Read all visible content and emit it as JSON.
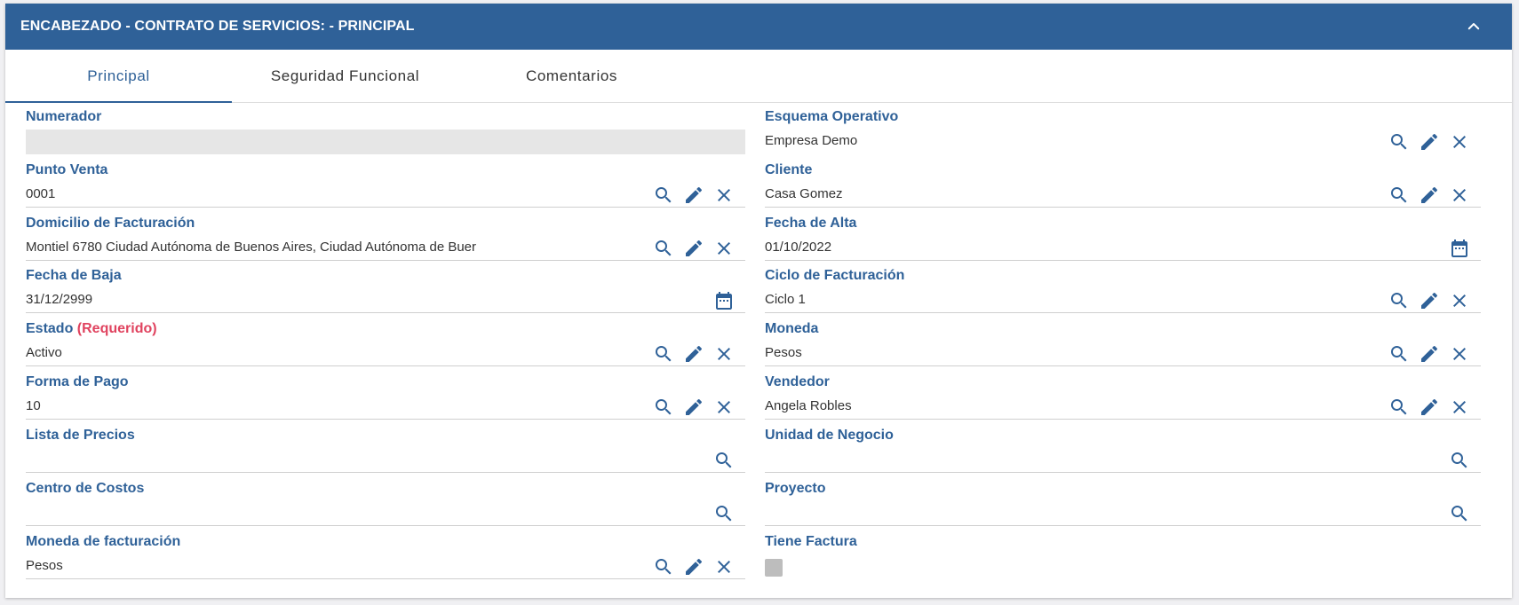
{
  "header": {
    "title": "ENCABEZADO - CONTRATO DE SERVICIOS: - PRINCIPAL",
    "collapse_icon": "chevron-up-icon"
  },
  "tabs": [
    {
      "label": "Principal",
      "active": true
    },
    {
      "label": "Seguridad Funcional",
      "active": false
    },
    {
      "label": "Comentarios",
      "active": false
    }
  ],
  "required_text": "(Requerido)",
  "colors": {
    "brand": "#2f6198",
    "required": "#e0435f"
  },
  "fields": {
    "numerador": {
      "label": "Numerador",
      "value": ""
    },
    "punto_venta": {
      "label": "Punto Venta",
      "value": "0001"
    },
    "domicilio": {
      "label": "Domicilio de Facturación",
      "value": "Montiel 6780  Ciudad Autónoma de Buenos Aires, Ciudad Autónoma de Buer"
    },
    "fecha_baja": {
      "label": "Fecha de Baja",
      "value": "31/12/2999"
    },
    "estado": {
      "label": "Estado",
      "value": "Activo"
    },
    "forma_pago": {
      "label": "Forma de Pago",
      "value": "10"
    },
    "lista_precios": {
      "label": "Lista de Precios",
      "value": ""
    },
    "centro_costos": {
      "label": "Centro de Costos",
      "value": ""
    },
    "moneda_facturacion": {
      "label": "Moneda de facturación",
      "value": "Pesos"
    },
    "esquema": {
      "label": "Esquema Operativo",
      "value": "Empresa Demo"
    },
    "cliente": {
      "label": "Cliente",
      "value": "Casa Gomez"
    },
    "fecha_alta": {
      "label": "Fecha de Alta",
      "value": "01/10/2022"
    },
    "ciclo": {
      "label": "Ciclo de Facturación",
      "value": "Ciclo 1"
    },
    "moneda": {
      "label": "Moneda",
      "value": "Pesos"
    },
    "vendedor": {
      "label": "Vendedor",
      "value": "Angela Robles"
    },
    "unidad_negocio": {
      "label": "Unidad de Negocio",
      "value": ""
    },
    "proyecto": {
      "label": "Proyecto",
      "value": ""
    },
    "tiene_factura": {
      "label": "Tiene Factura",
      "checked": false
    }
  }
}
